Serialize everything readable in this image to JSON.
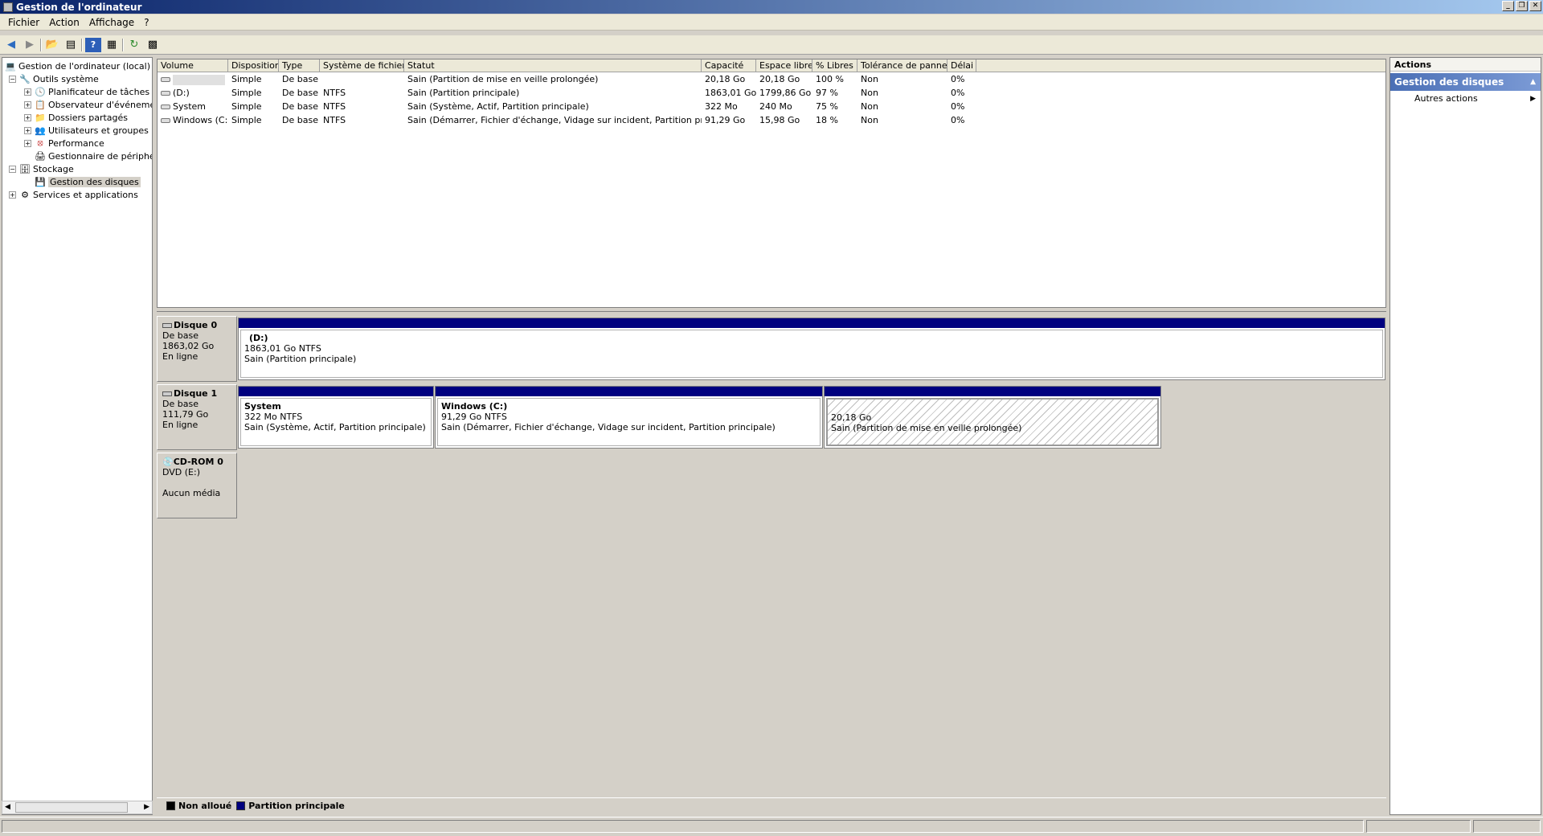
{
  "window": {
    "title": "Gestion de l'ordinateur",
    "controls": [
      "_",
      "❐",
      "✕"
    ]
  },
  "menu": [
    "Fichier",
    "Action",
    "Affichage",
    "?"
  ],
  "toolbar": {
    "icons": [
      "back-icon",
      "forward-icon",
      "up-icon",
      "show-hide-tree-icon",
      "help-icon",
      "properties-icon",
      "refresh-icon",
      "export-icon"
    ]
  },
  "tree": [
    {
      "label": "Gestion de l'ordinateur (local)",
      "level": 0,
      "expander": "",
      "icon": "computer-icon"
    },
    {
      "label": "Outils système",
      "level": 1,
      "expander": "−",
      "icon": "tools-icon"
    },
    {
      "label": "Planificateur de tâches",
      "level": 2,
      "expander": "+",
      "icon": "clock-icon"
    },
    {
      "label": "Observateur d'événements",
      "level": 2,
      "expander": "+",
      "icon": "event-viewer-icon"
    },
    {
      "label": "Dossiers partagés",
      "level": 2,
      "expander": "+",
      "icon": "shared-folder-icon"
    },
    {
      "label": "Utilisateurs et groupes locaux",
      "level": 2,
      "expander": "+",
      "icon": "users-icon"
    },
    {
      "label": "Performance",
      "level": 2,
      "expander": "+",
      "icon": "performance-icon"
    },
    {
      "label": "Gestionnaire de périphériques",
      "level": 2,
      "expander": "",
      "icon": "device-manager-icon"
    },
    {
      "label": "Stockage",
      "level": 1,
      "expander": "−",
      "icon": "storage-icon"
    },
    {
      "label": "Gestion des disques",
      "level": 2,
      "expander": "",
      "icon": "disk-management-icon",
      "selected": true
    },
    {
      "label": "Services et applications",
      "level": 0,
      "expander": "+",
      "icon": "services-icon"
    }
  ],
  "volume_table": {
    "columns": [
      "Volume",
      "Disposition",
      "Type",
      "Système de fichiers",
      "Statut",
      "Capacité",
      "Espace libre",
      "% Libres",
      "Tolérance de pannes",
      "Délai"
    ],
    "rows": [
      [
        "",
        "Simple",
        "De base",
        "",
        "Sain (Partition de mise en veille prolongée)",
        "20,18 Go",
        "20,18 Go",
        "100 %",
        "Non",
        "0%"
      ],
      [
        "(D:)",
        "Simple",
        "De base",
        "NTFS",
        "Sain (Partition principale)",
        "1863,01 Go",
        "1799,86 Go",
        "97 %",
        "Non",
        "0%"
      ],
      [
        "System",
        "Simple",
        "De base",
        "NTFS",
        "Sain (Système, Actif, Partition principale)",
        "322 Mo",
        "240 Mo",
        "75 %",
        "Non",
        "0%"
      ],
      [
        "Windows (C:)",
        "Simple",
        "De base",
        "NTFS",
        "Sain (Démarrer, Fichier d'échange, Vidage sur incident, Partition principale)",
        "91,29 Go",
        "15,98 Go",
        "18 %",
        "Non",
        "0%"
      ]
    ]
  },
  "disks": [
    {
      "name": "Disque 0",
      "type": "De base",
      "size": "1863,02 Go",
      "status": "En ligne",
      "partitions": [
        {
          "name": "(D:)",
          "size": "1863,01 Go NTFS",
          "status": "Sain (Partition principale)",
          "kind": "primary"
        }
      ]
    },
    {
      "name": "Disque 1",
      "type": "De base",
      "size": "111,79 Go",
      "status": "En ligne",
      "partitions": [
        {
          "name": "System",
          "size": "322 Mo NTFS",
          "status": "Sain (Système, Actif, Partition principale)",
          "kind": "primary"
        },
        {
          "name": "Windows  (C:)",
          "size": "91,29 Go NTFS",
          "status": "Sain (Démarrer, Fichier d'échange, Vidage sur incident, Partition principale)",
          "kind": "primary"
        },
        {
          "name": "",
          "size": "20,18 Go",
          "status": "Sain (Partition de mise en veille prolongée)",
          "kind": "hibernation"
        }
      ]
    },
    {
      "name": "CD-ROM 0",
      "type": "DVD (E:)",
      "size": "",
      "status": "Aucun média",
      "partitions": []
    }
  ],
  "legend": [
    {
      "label": "Non alloué",
      "color": "#000000"
    },
    {
      "label": "Partition principale",
      "color": "#00007f"
    }
  ],
  "actions": {
    "title": "Actions",
    "section": "Gestion des disques",
    "items": [
      "Autres actions"
    ]
  }
}
